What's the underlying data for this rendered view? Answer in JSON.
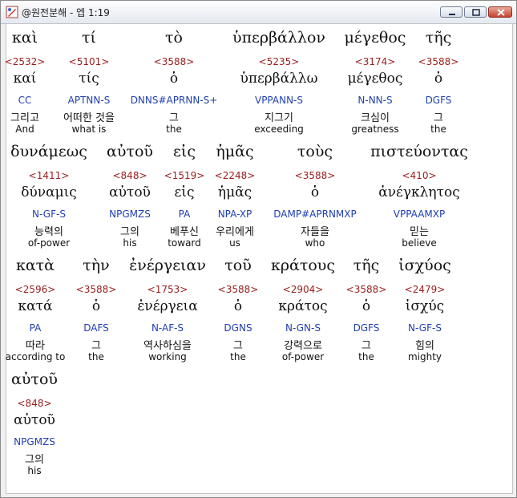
{
  "window": {
    "title": "@원전분해 - 엡 1:19"
  },
  "rows": [
    {
      "words": [
        {
          "greek": "καὶ",
          "strong": "<2532>",
          "lemma": "καί",
          "morph": "CC",
          "korean": "그리고",
          "english": "And"
        },
        {
          "greek": "τί",
          "strong": "<5101>",
          "lemma": "τίς",
          "morph": "APTNN-S",
          "korean": "어떠한 것을",
          "english": "what is"
        },
        {
          "greek": "τὸ",
          "strong": "<3588>",
          "lemma": "ὁ",
          "morph": "DNNS#APRNN-S+",
          "korean": "그",
          "english": "the"
        },
        {
          "greek": "ὑπερβάλλον",
          "strong": "<5235>",
          "lemma": "ὑπερβάλλω",
          "morph": "VPPANN-S",
          "korean": "지그기",
          "english": "exceeding"
        },
        {
          "greek": "μέγεθος",
          "strong": "<3174>",
          "lemma": "μέγεθος",
          "morph": "N-NN-S",
          "korean": "크심이",
          "english": "greatness"
        },
        {
          "greek": "τῆς",
          "strong": "<3588>",
          "lemma": "ὁ",
          "morph": "DGFS",
          "korean": "그",
          "english": "the"
        }
      ]
    },
    {
      "words": [
        {
          "greek": "δυνάμεως",
          "strong": "<1411>",
          "lemma": "δύναμις",
          "morph": "N-GF-S",
          "korean": "능력의",
          "english": "of-power"
        },
        {
          "greek": "αὐτοῦ",
          "strong": "<848>",
          "lemma": "αὐτοῦ",
          "morph": "NPGMZS",
          "korean": "그의",
          "english": "his"
        },
        {
          "greek": "εἰς",
          "strong": "<1519>",
          "lemma": "εἰς",
          "morph": "PA",
          "korean": "베푸신",
          "english": "toward"
        },
        {
          "greek": "ἡμᾶς",
          "strong": "<2248>",
          "lemma": "ἡμᾶς",
          "morph": "NPA-XP",
          "korean": "우리에게",
          "english": "us"
        },
        {
          "greek": "τοὺς",
          "strong": "<3588>",
          "lemma": "ὁ",
          "morph": "DAMP#APRNMXP",
          "korean": "자들을",
          "english": "who"
        },
        {
          "greek": "πιστεύοντας",
          "strong": "<410>",
          "lemma": "ἀνέγκλητος",
          "morph": "VPPAAMXP",
          "korean": "믿는",
          "english": "believe"
        }
      ]
    },
    {
      "words": [
        {
          "greek": "κατὰ",
          "strong": "<2596>",
          "lemma": "κατά",
          "morph": "PA",
          "korean": "따라",
          "english": "according to"
        },
        {
          "greek": "τὴν",
          "strong": "<3588>",
          "lemma": "ὁ",
          "morph": "DAFS",
          "korean": "그",
          "english": "the"
        },
        {
          "greek": "ἐνέργειαν",
          "strong": "<1753>",
          "lemma": "ἐνέργεια",
          "morph": "N-AF-S",
          "korean": "역사하심을",
          "english": "working"
        },
        {
          "greek": "τοῦ",
          "strong": "<3588>",
          "lemma": "ὁ",
          "morph": "DGNS",
          "korean": "그",
          "english": "the"
        },
        {
          "greek": "κράτους",
          "strong": "<2904>",
          "lemma": "κράτος",
          "morph": "N-GN-S",
          "korean": "강력으로",
          "english": "of-power"
        },
        {
          "greek": "τῆς",
          "strong": "<3588>",
          "lemma": "ὁ",
          "morph": "DGFS",
          "korean": "그",
          "english": "the"
        },
        {
          "greek": "ἰσχύος",
          "strong": "<2479>",
          "lemma": "ἰσχύς",
          "morph": "N-GF-S",
          "korean": "힘의",
          "english": "mighty"
        }
      ]
    },
    {
      "words": [
        {
          "greek": "αὐτοῦ",
          "strong": "<848>",
          "lemma": "αὐτοῦ",
          "morph": "NPGMZS",
          "korean": "그의",
          "english": "his"
        }
      ]
    }
  ]
}
